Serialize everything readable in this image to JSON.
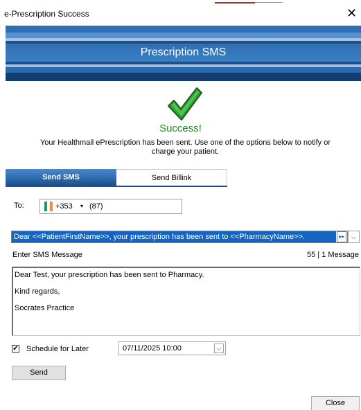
{
  "window": {
    "title": "e-Prescription Success",
    "close_glyph": "✕"
  },
  "banner": {
    "title": "Prescription SMS"
  },
  "status": {
    "icon": "checkmark-icon",
    "title": "Success!",
    "message_line1": "Your Healthmail ePrescription has been sent. Use one of the options below to notify or",
    "message_line2": "charge your patient."
  },
  "tabs": [
    {
      "label": "Send SMS",
      "active": true
    },
    {
      "label": "Send Billink",
      "active": false
    }
  ],
  "sms": {
    "to_label": "To:",
    "country_flag": "ireland-flag-icon",
    "country_code": "+353",
    "country_dropdown_glyph": "▾",
    "number": "(87)",
    "template_text": "Dear <<PatientFirstName>>, your prescription has been sent to <<PharmacyName>>.",
    "template_insert_glyph": "▸▸",
    "template_dropdown_glyph": "⌵",
    "enter_label": "Enter SMS Message",
    "char_count": "55 | 1 Message",
    "message_lines": [
      "Dear Test, your prescription has been sent to Pharmacy.",
      "Kind regards,",
      "Socrates Practice"
    ],
    "schedule_checked": true,
    "schedule_check_glyph": "✔",
    "schedule_label": "Schedule for Later",
    "schedule_datetime": "07/11/2025 10:00",
    "date_dropdown_glyph": "⌵",
    "send_label": "Send"
  },
  "footer": {
    "close_label": "Close"
  },
  "colors": {
    "accent_blue": "#1565c0",
    "success_green": "#1e8a1e",
    "flag_green": "#169b62",
    "flag_white": "#ffffff",
    "flag_orange": "#ff883e"
  }
}
